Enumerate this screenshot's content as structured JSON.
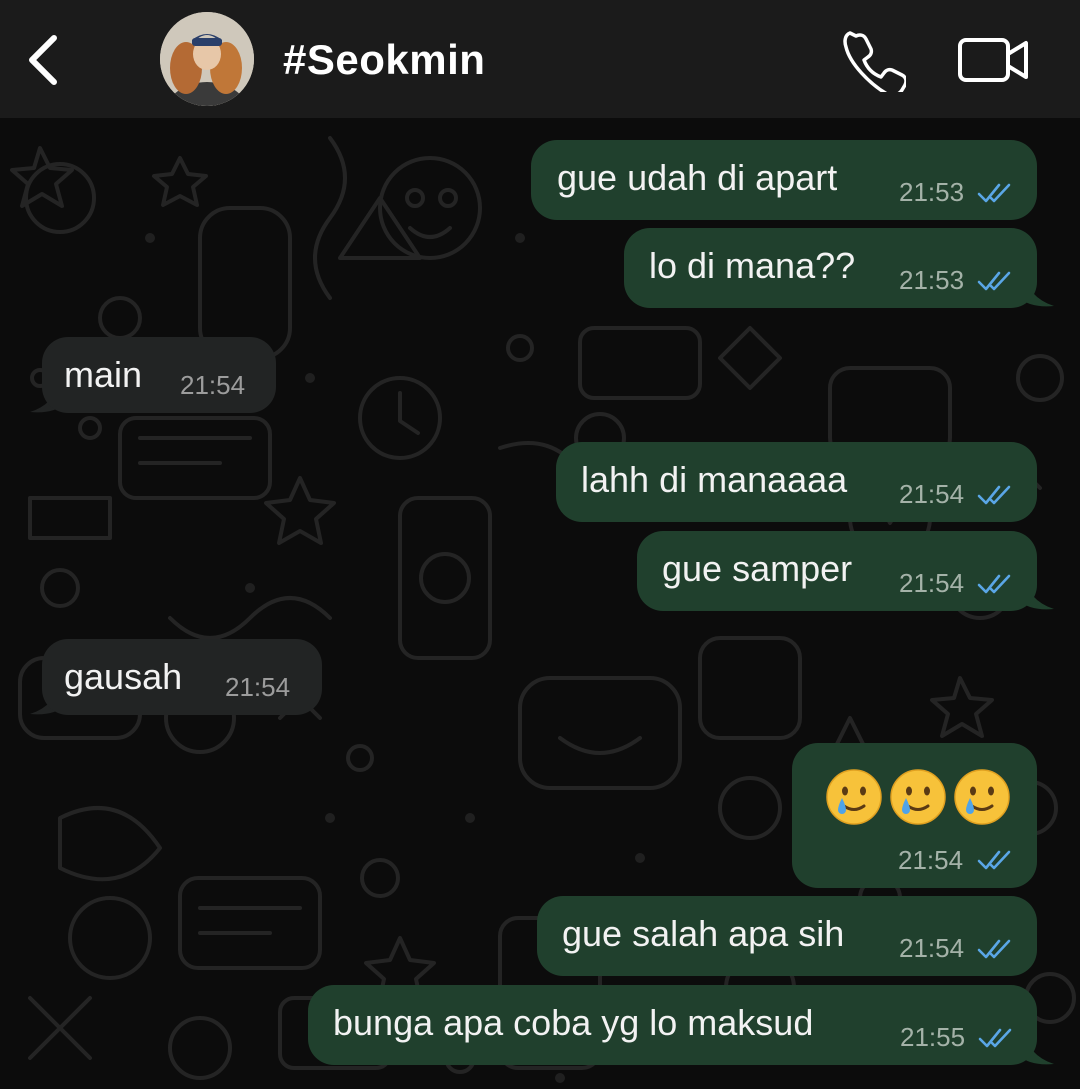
{
  "header": {
    "contact_name": "#Seokmin"
  },
  "messages": [
    {
      "text": "gue udah di apart",
      "time": "21:53"
    },
    {
      "text": "lo di mana??",
      "time": "21:53"
    },
    {
      "text": "main",
      "time": "21:54"
    },
    {
      "text": "lahh di manaaaa",
      "time": "21:54"
    },
    {
      "text": "gue samper",
      "time": "21:54"
    },
    {
      "text": "gausah",
      "time": "21:54"
    },
    {
      "text": "🥲🥲🥲",
      "time": "21:54"
    },
    {
      "text": "gue salah apa sih",
      "time": "21:54"
    },
    {
      "text": "bunga apa coba yg lo maksud",
      "time": "21:55"
    }
  ],
  "colors": {
    "header_bg": "#1b1b1b",
    "outgoing_bubble": "#20402d",
    "incoming_bubble": "#222424",
    "read_ticks": "#5aa6e6"
  }
}
